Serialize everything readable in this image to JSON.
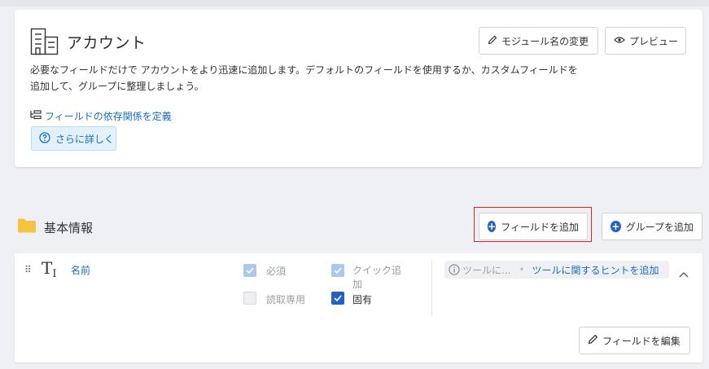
{
  "module": {
    "title": "アカウント",
    "rename_label": "モジュール名の変更",
    "preview_label": "プレビュー",
    "description": "必要なフィールドだけで アカウントをより迅速に追加します。デフォルトのフィールドを使用するか、カスタムフィールドを追加して、グループに整理しましょう。",
    "dependency_link": "フィールドの依存関係を定義",
    "learn_more": "さらに詳しく"
  },
  "group": {
    "title": "基本情報",
    "add_field_label": "フィールドを追加",
    "add_group_label": "グループを追加"
  },
  "field": {
    "name": "名前",
    "required_label": "必須",
    "quick_add_label": "クイック追加",
    "readonly_label": "読取専用",
    "unique_label": "固有",
    "tooltip_placeholder": "ツールに...",
    "tooltip_add_link": "ツールに関するヒントを追加",
    "edit_label": "フィールドを編集",
    "required_checked": true,
    "quick_add_checked": true,
    "readonly_checked": false,
    "unique_checked": true
  },
  "icons": {
    "module": "building-icon",
    "rename": "pencil-icon",
    "preview": "eye-icon",
    "dependency": "hierarchy-icon",
    "learn": "help-circle-icon",
    "folder": "folder-icon",
    "add": "plus-circle-icon",
    "drag": "drag-handle-icon",
    "text_type": "text-type-icon",
    "info": "info-icon",
    "collapse": "chevron-up-icon",
    "edit": "pencil-icon"
  },
  "colors": {
    "accent": "#2461c4",
    "link": "#1a6dc2",
    "highlight_border": "#d9262c",
    "folder": "#f5c342"
  }
}
